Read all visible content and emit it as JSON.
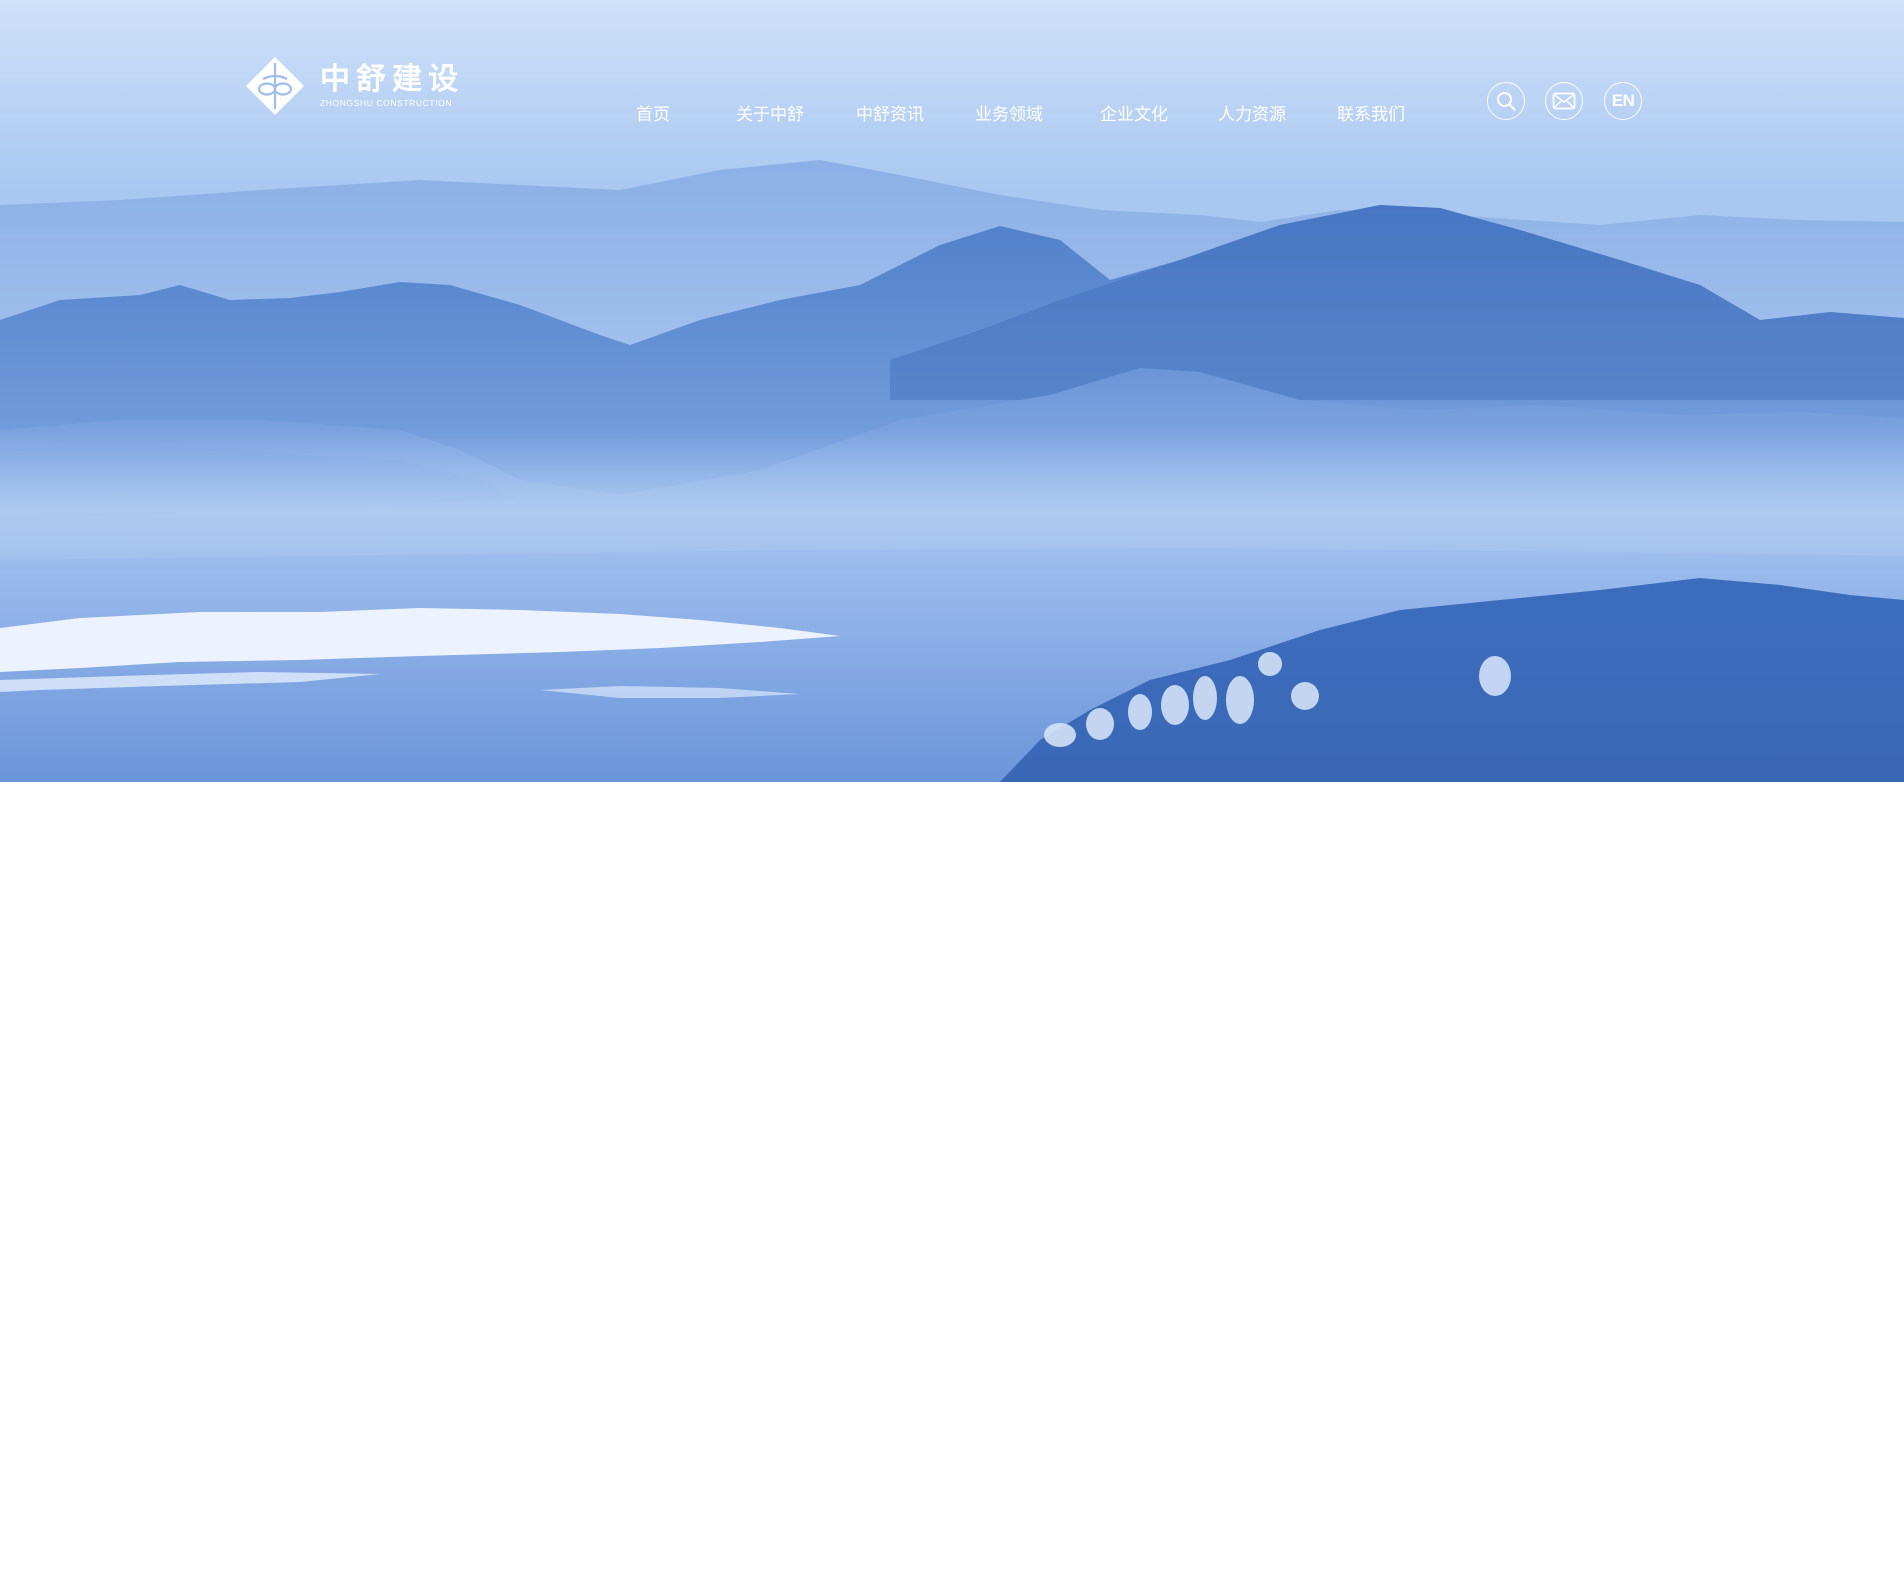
{
  "header": {
    "logo": {
      "cn": "中舒建设",
      "en": "ZHONGSHU CONSTRUCTION"
    },
    "nav": [
      {
        "label": "首页"
      },
      {
        "label": "关于中舒"
      },
      {
        "label": "中舒资讯"
      },
      {
        "label": "业务领域"
      },
      {
        "label": "企业文化"
      },
      {
        "label": "人力资源"
      },
      {
        "label": "联系我们"
      }
    ],
    "icons": {
      "search": "search-icon",
      "mail": "mail-icon",
      "language": "EN"
    }
  },
  "hero": {
    "image": "misty-blue-mountains-landscape"
  },
  "colors": {
    "sky": "#c7dcf7",
    "mountain_far": "#8fb3e6",
    "mountain_mid": "#5a86cf",
    "mountain_near": "#3f6fbd",
    "nav_text": "#ffffff"
  }
}
